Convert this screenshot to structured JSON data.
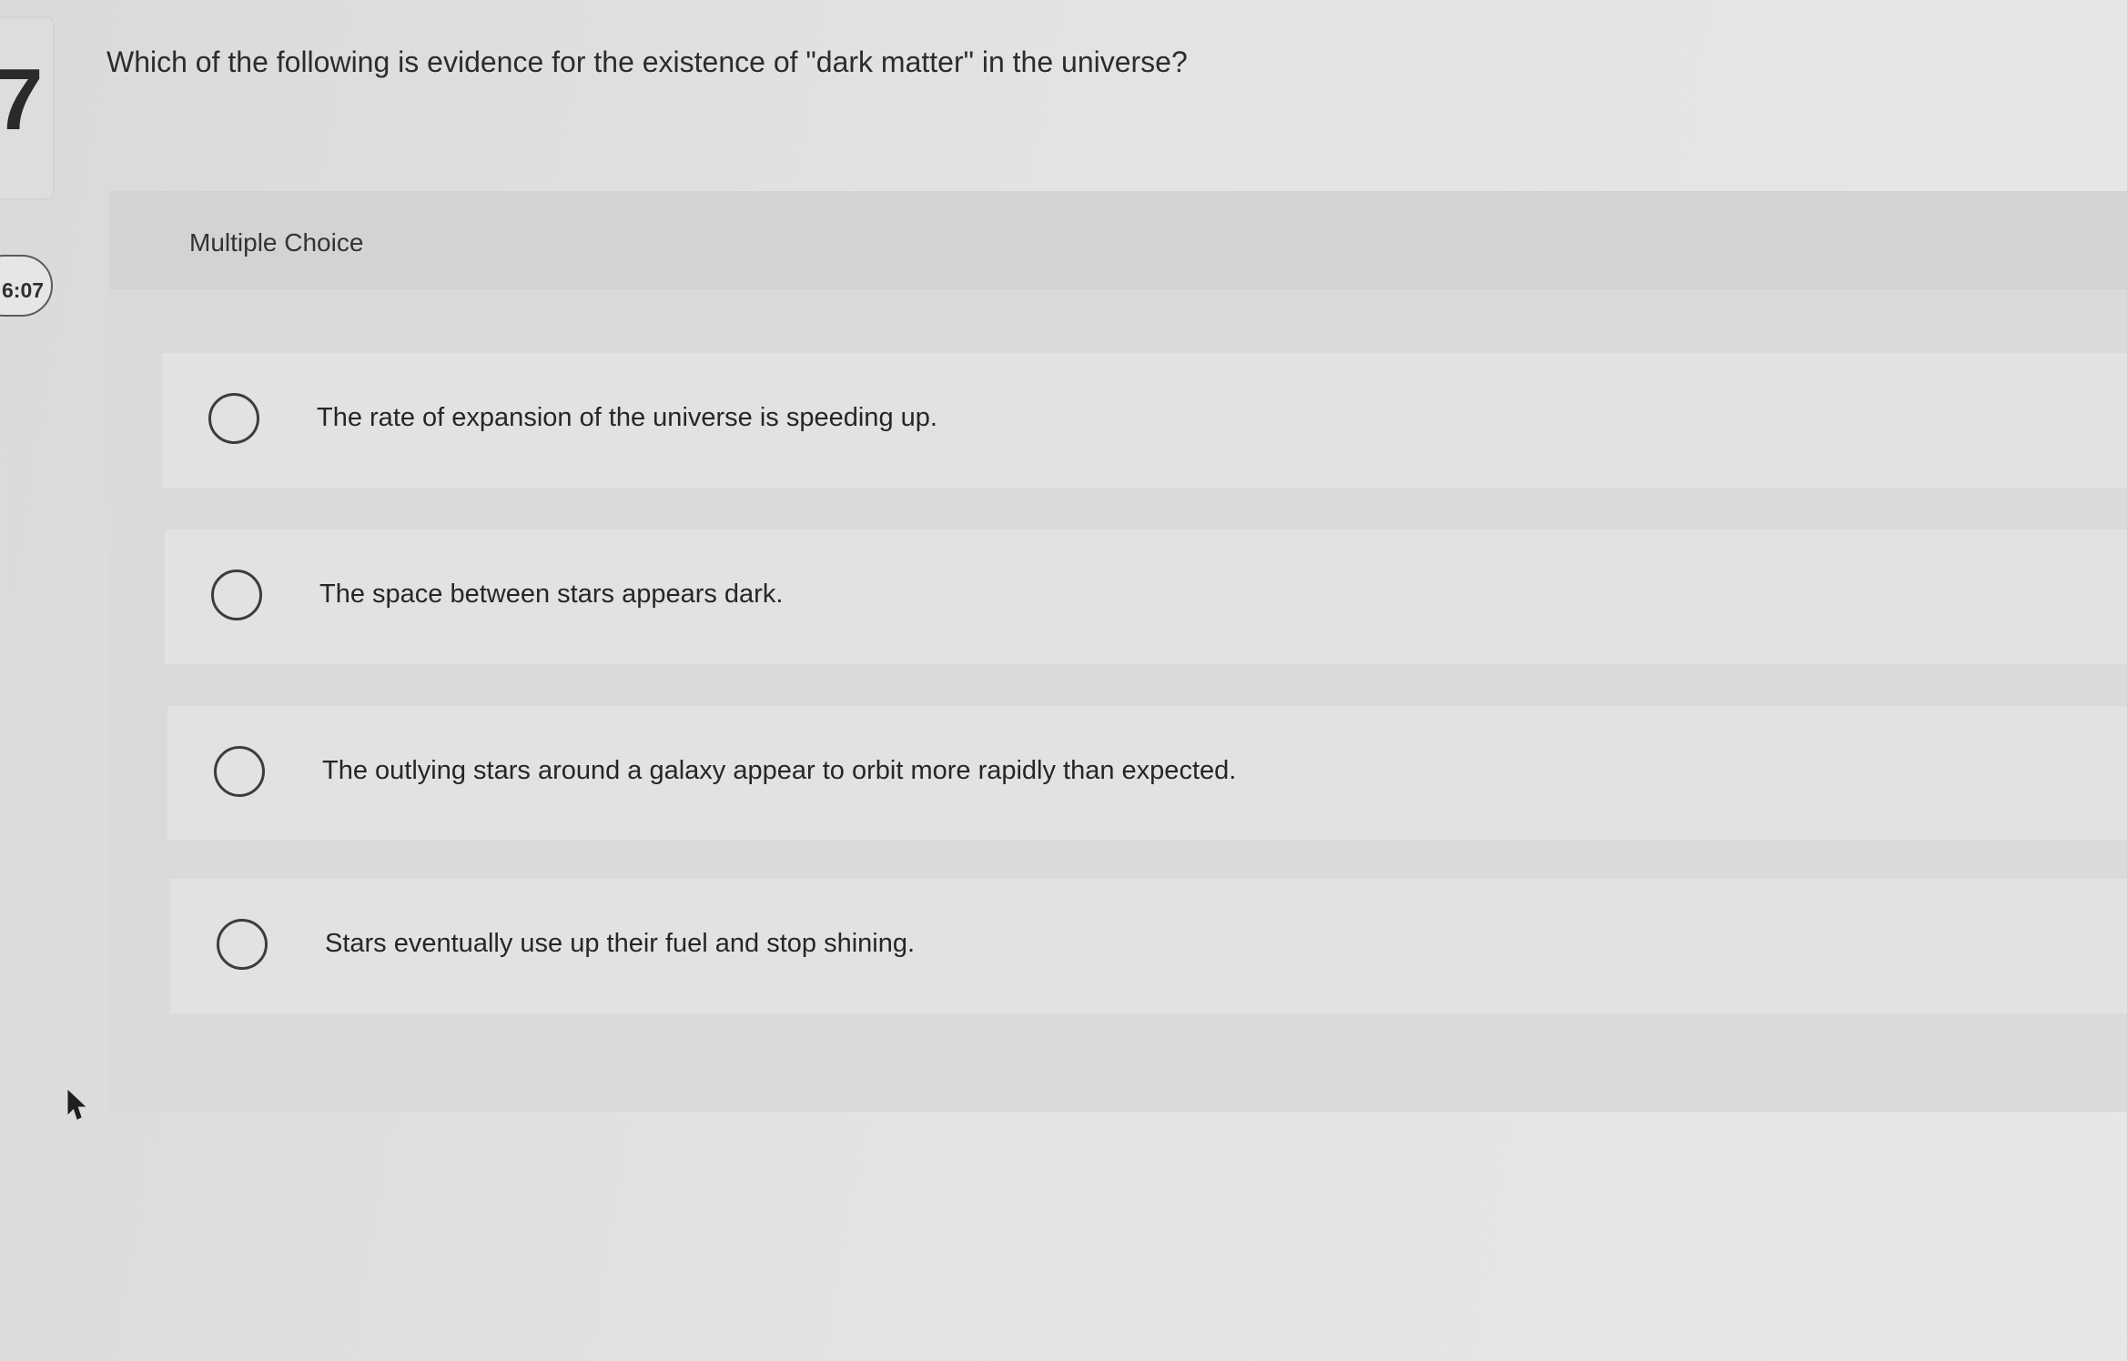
{
  "question": {
    "number": "7",
    "text": "Which of the following is evidence for the existence of \"dark matter\" in the universe?"
  },
  "timer": {
    "text": "6:07"
  },
  "quiz": {
    "type_label": "Multiple Choice",
    "options": [
      {
        "label": "The rate of expansion of the universe is speeding up.",
        "selected": false
      },
      {
        "label": "The space between stars appears dark.",
        "selected": false
      },
      {
        "label": "The outlying stars around a galaxy appear to orbit more rapidly than expected.",
        "selected": false
      },
      {
        "label": "Stars eventually use up their fuel and stop shining.",
        "selected": false
      }
    ]
  },
  "icons": {
    "cursor": "mouse-pointer-icon",
    "radio": "radio-unselected-icon"
  }
}
